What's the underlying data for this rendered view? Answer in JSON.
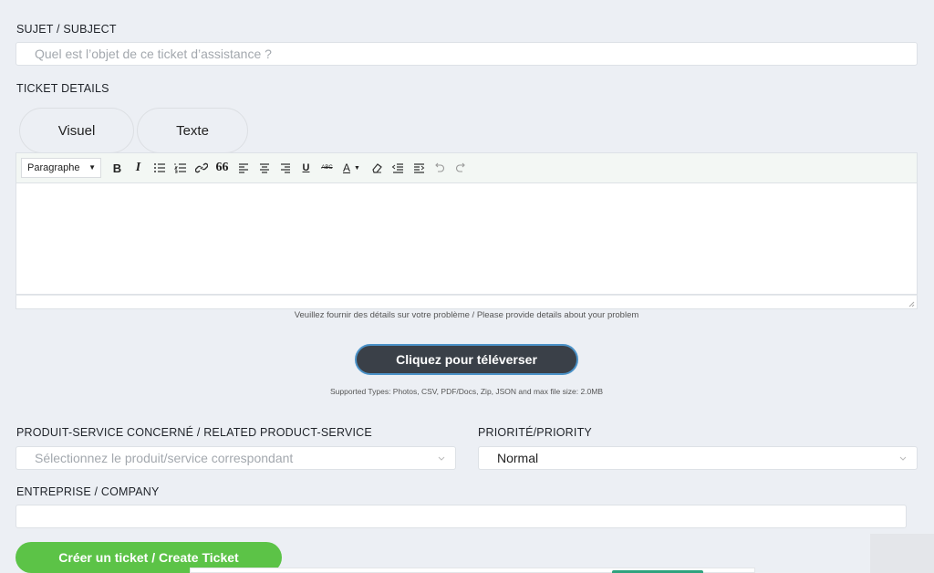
{
  "subject": {
    "label": "SUJET / SUBJECT",
    "placeholder": "Quel est l’objet de ce ticket d’assistance ?"
  },
  "details": {
    "label": "TICKET DETAILS",
    "tabs": [
      "Visuel",
      "Texte"
    ],
    "format_select": "Paragraphe",
    "toolbar_icons": [
      "bold-icon",
      "italic-icon",
      "bullet-list-icon",
      "numbered-list-icon",
      "link-icon",
      "blockquote-icon",
      "align-left-icon",
      "align-center-icon",
      "align-right-icon",
      "underline-icon",
      "strikethrough-icon",
      "text-color-icon",
      "clear-format-icon",
      "outdent-icon",
      "indent-icon",
      "undo-icon",
      "redo-icon"
    ],
    "toolbar_glyphs": {
      "bold": "B",
      "italic": "I",
      "underline": "U",
      "strike": "ABC",
      "color": "A",
      "quote": "66"
    },
    "hint": "Veuillez fournir des détails sur votre problème / Please provide details about your problem"
  },
  "upload": {
    "button": "Cliquez pour téléverser",
    "supported": "Supported Types: Photos, CSV, PDF/Docs, Zip, JSON and max file size: 2.0MB"
  },
  "product": {
    "label": "PRODUIT-SERVICE CONCERNÉ / RELATED PRODUCT-SERVICE",
    "placeholder": "Sélectionnez le produit/service correspondant"
  },
  "priority": {
    "label": "PRIORITÉ/PRIORITY",
    "value": "Normal"
  },
  "company": {
    "label": "ENTREPRISE / COMPANY",
    "value": ""
  },
  "submit": {
    "label": "Créer un ticket / Create Ticket"
  },
  "colors": {
    "background": "#eceff4",
    "upload_button": "#3a4048",
    "upload_border": "#4b92c8",
    "submit_button": "#5cc347"
  }
}
